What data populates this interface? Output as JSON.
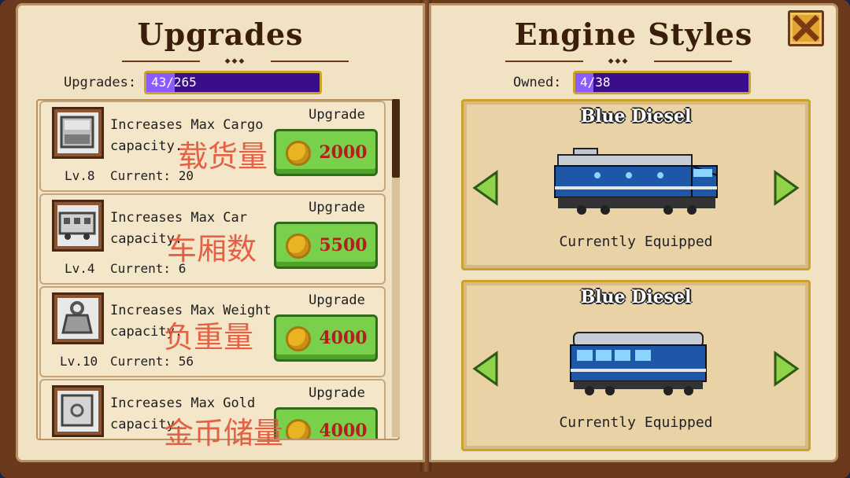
{
  "left_page": {
    "title": "Upgrades",
    "counter_label": "Upgrades:",
    "counter_value": "43/265",
    "counter_fill_fraction": 0.162
  },
  "right_page": {
    "title": "Engine Styles",
    "counter_label": "Owned:",
    "counter_value": "4/38",
    "counter_fill_fraction": 0.105
  },
  "upgrades": [
    {
      "icon": "cargo-crate-icon",
      "desc1": "Increases Max Cargo",
      "desc2": "capacity.",
      "level": "Lv.8",
      "current": "Current: 20",
      "upgrade_label": "Upgrade",
      "price": "2000",
      "annotation": "载货量"
    },
    {
      "icon": "train-car-icon",
      "desc1": "Increases Max Car",
      "desc2": "capacity.",
      "level": "Lv.4",
      "current": "Current: 6",
      "upgrade_label": "Upgrade",
      "price": "5500",
      "annotation": "车厢数"
    },
    {
      "icon": "weight-icon",
      "desc1": "Increases Max Weight",
      "desc2": "capacity.",
      "level": "Lv.10",
      "current": "Current: 56",
      "upgrade_label": "Upgrade",
      "price": "4000",
      "annotation": "负重量"
    },
    {
      "icon": "safe-icon",
      "desc1": "Increases Max Gold",
      "desc2": "capacity.",
      "level": "",
      "current": "",
      "upgrade_label": "Upgrade",
      "price": "4000",
      "annotation": "金币储量"
    }
  ],
  "engine_styles": [
    {
      "name": "Blue Diesel",
      "status": "Currently Equipped",
      "icon": "blue-diesel-locomotive"
    },
    {
      "name": "Blue Diesel",
      "status": "Currently Equipped",
      "icon": "blue-diesel-passenger-car"
    }
  ],
  "colors": {
    "book_leather": "#6b3a1c",
    "page": "#f1e2c4",
    "bar_purple": "#3a0d8a",
    "button_green": "#79d04a",
    "price_red": "#b31e1e",
    "gold": "#c9a227"
  }
}
